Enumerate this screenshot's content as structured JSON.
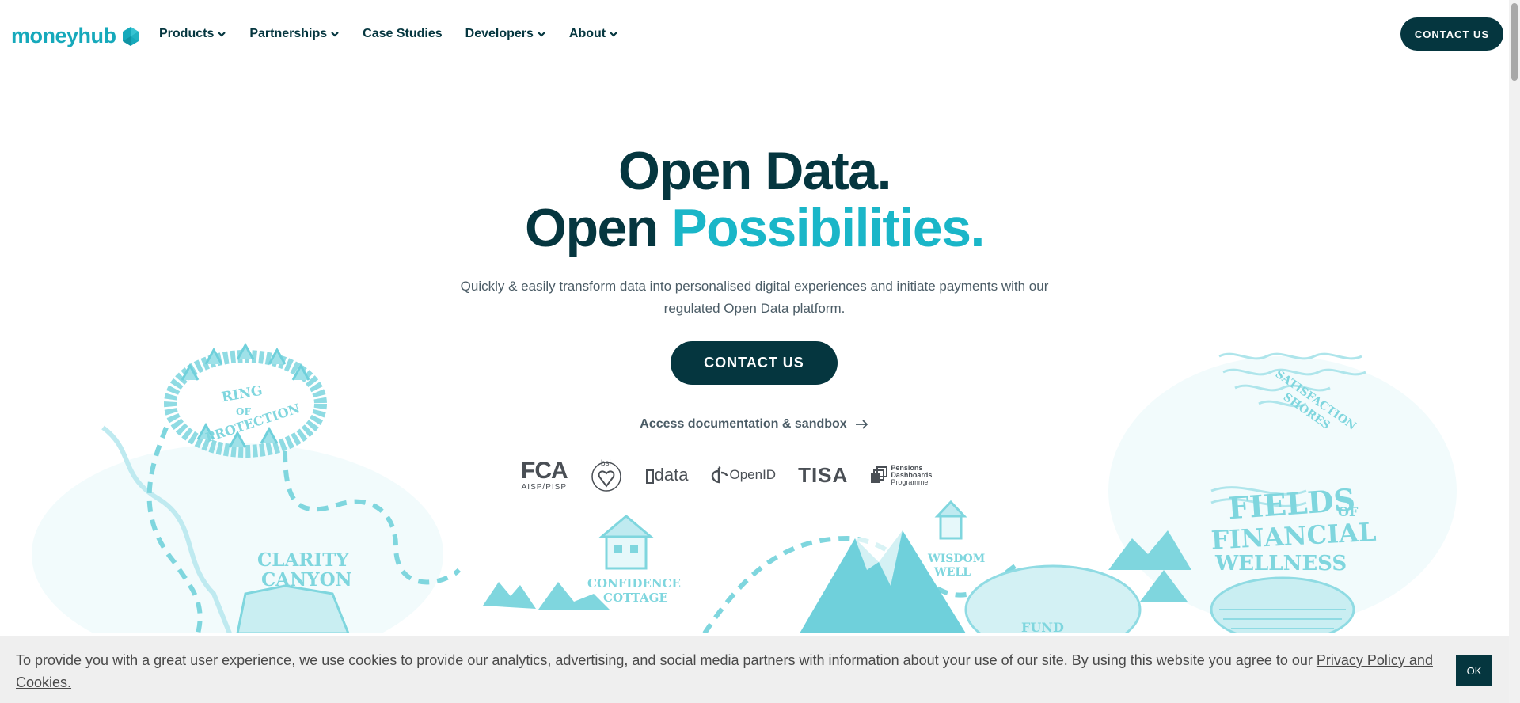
{
  "brand": {
    "name": "moneyhub",
    "color": "#16a9bb",
    "dark": "#05363f"
  },
  "nav": {
    "items": [
      {
        "label": "Products",
        "has_dropdown": true
      },
      {
        "label": "Partnerships",
        "has_dropdown": true
      },
      {
        "label": "Case Studies",
        "has_dropdown": false
      },
      {
        "label": "Developers",
        "has_dropdown": true
      },
      {
        "label": "About",
        "has_dropdown": true
      }
    ],
    "contact_label": "CONTACT US"
  },
  "hero": {
    "title_line1": "Open Data.",
    "title_line2_a": "Open ",
    "title_line2_b": "Possibilities.",
    "subtitle": "Quickly & easily transform data into personalised digital experiences and initiate payments with our regulated Open Data platform.",
    "cta_label": "CONTACT US",
    "docs_label": "Access documentation & sandbox"
  },
  "accreditations": {
    "fca_main": "FCA",
    "fca_sub": "AISP/PISP",
    "bsi": "bsi",
    "smartdata": "data",
    "openid": "OpenID",
    "tisa": "TISA",
    "pensions_line1": "Pensions",
    "pensions_line2": "Dashboards",
    "pensions_line3": "Programme"
  },
  "map_labels": {
    "ring_1": "RING",
    "ring_2": "OF",
    "ring_3": "PROTECTION",
    "canyon_1": "CLARITY",
    "canyon_2": "CANYON",
    "cottage_1": "CONFIDENCE",
    "cottage_2": "COTTAGE",
    "well_1": "WISDOM",
    "well_2": "WELL",
    "fund": "FUND",
    "shores_1": "SATISFACTION",
    "shores_2": "SHORES",
    "fields_1": "FIELDS",
    "fields_of": "OF",
    "fields_2": "FINANCIAL",
    "fields_3": "WELLNESS"
  },
  "cookie": {
    "text": "To provide you with a great user experience, we use cookies to provide our analytics, advertising, and social media partners with information about your use of our site. By using this website you agree to our ",
    "link_label": "Privacy Policy and Cookies.",
    "ok_label": "OK"
  },
  "icons": {
    "nav_chevron": "chevron-down-icon",
    "docs_arrow": "arrow-right-icon",
    "logo_mark": "moneyhub-hexagon-icon"
  }
}
